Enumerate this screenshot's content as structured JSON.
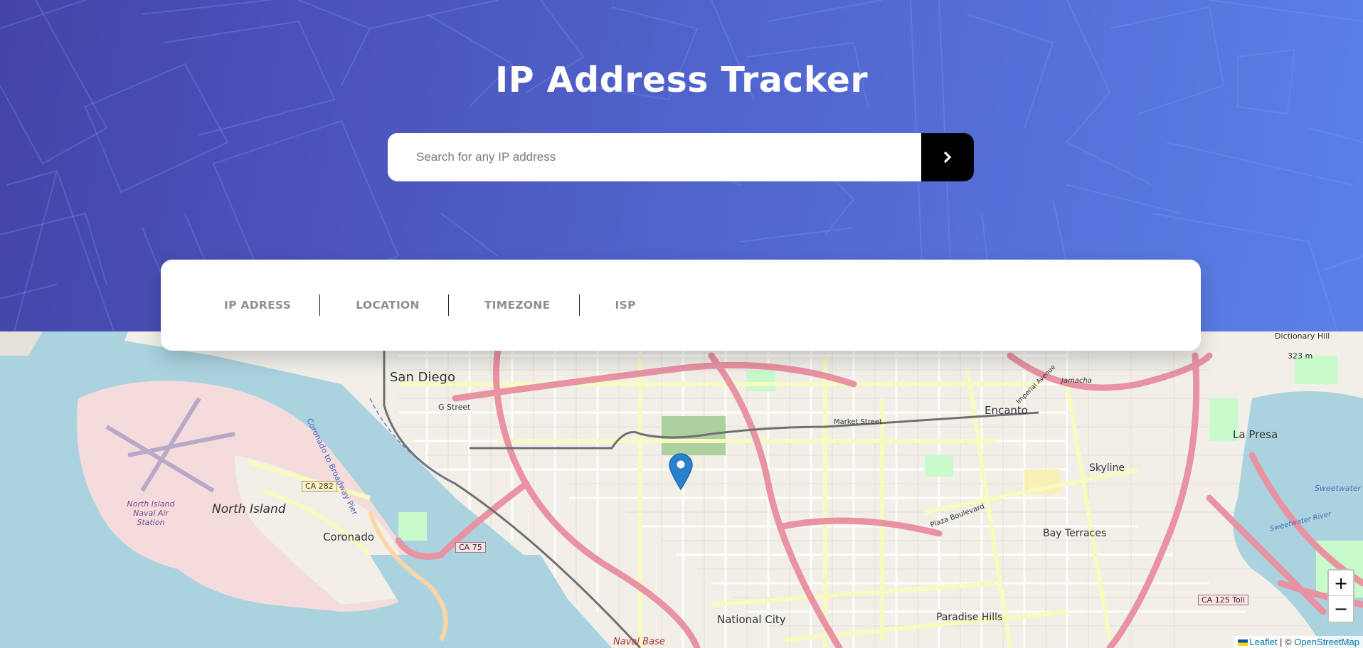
{
  "header": {
    "title": "IP Address Tracker",
    "search_placeholder": "Search for any IP address",
    "submit_icon": "chevron-right-icon"
  },
  "info": {
    "items": [
      {
        "label": "IP ADRESS"
      },
      {
        "label": "LOCATION"
      },
      {
        "label": "TIMEZONE"
      },
      {
        "label": "ISP"
      }
    ]
  },
  "map": {
    "labels": {
      "san_diego": "San Diego",
      "g_street": "G Street",
      "coronado_pier": "Coronado to Broadway Pier",
      "north_island": "North Island",
      "naval_air": "North Island Naval Air Station",
      "coronado": "Coronado",
      "ca282": "CA 282",
      "ca75": "CA 75",
      "national_city": "National City",
      "naval_base": "Naval Base",
      "encanto": "Encanto",
      "market_street": "Market Street",
      "la_presa": "La Presa",
      "skyline": "Skyline",
      "bay_terraces": "Bay Terraces",
      "plaza_boulevard": "Plaza Boulevard",
      "paradise_hills": "Paradise Hills",
      "ca125": "CA 125 Toll",
      "dictionary_hill": "Dictionary Hill",
      "elevation": "323 m",
      "jamacha": "Jamacha",
      "imperial": "Imperial Avenue",
      "sweetwater": "Sweetwater Reserv",
      "sweetwater_river": "Sweetwater River"
    },
    "zoom_in": "+",
    "zoom_out": "−",
    "attribution": {
      "leaflet": "Leaflet",
      "separator": " | © ",
      "osm": "OpenStreetMap"
    },
    "marker_icon": "map-pin-icon",
    "colors": {
      "water": "#aad3df",
      "land": "#f2efe9",
      "motorway": "#e892a2",
      "primary": "#f8fabf",
      "park": "#c8facc",
      "marker": "#2a81cb"
    }
  }
}
